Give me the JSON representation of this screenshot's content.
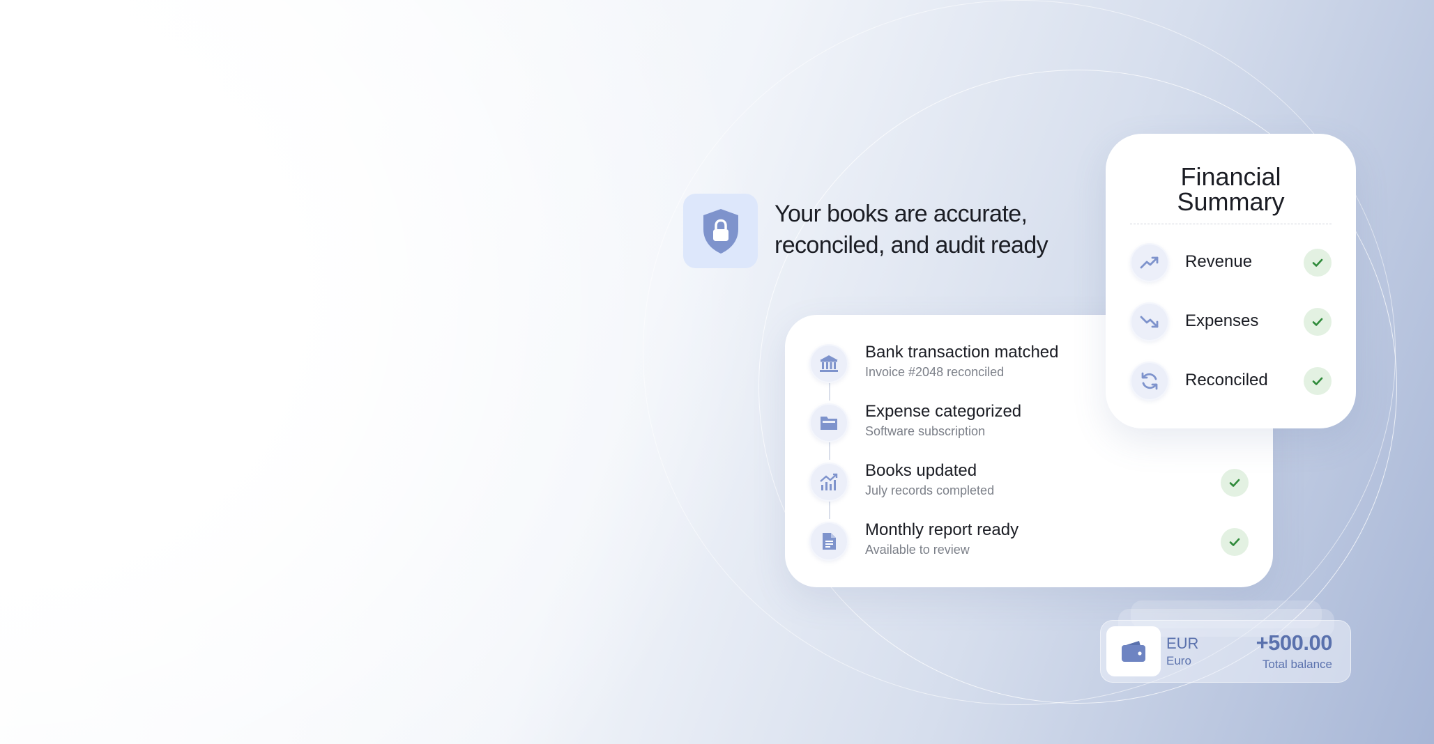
{
  "headline": {
    "line1": "Your books are accurate,",
    "line2": "reconciled, and audit ready"
  },
  "activity": [
    {
      "icon": "bank-icon",
      "title": "Bank transaction matched",
      "subtitle": "Invoice #2048 reconciled"
    },
    {
      "icon": "folder-icon",
      "title": "Expense categorized",
      "subtitle": "Software subscription"
    },
    {
      "icon": "chart-icon",
      "title": "Books updated",
      "subtitle": "July records completed"
    },
    {
      "icon": "document-icon",
      "title": "Monthly report ready",
      "subtitle": "Available to review"
    }
  ],
  "summary": {
    "title_line1": "Financial",
    "title_line2": "Summary",
    "items": [
      {
        "icon": "trend-up-icon",
        "label": "Revenue"
      },
      {
        "icon": "trend-down-icon",
        "label": "Expenses"
      },
      {
        "icon": "refresh-icon",
        "label": "Reconciled"
      }
    ]
  },
  "balance": {
    "currency_code": "EUR",
    "currency_name": "Euro",
    "amount": "+500.00",
    "label": "Total balance"
  },
  "colors": {
    "accent": "#7e93cc",
    "check_bg": "#e3f1e2",
    "check": "#2f8a3a",
    "balance_text": "#5a71ad"
  }
}
